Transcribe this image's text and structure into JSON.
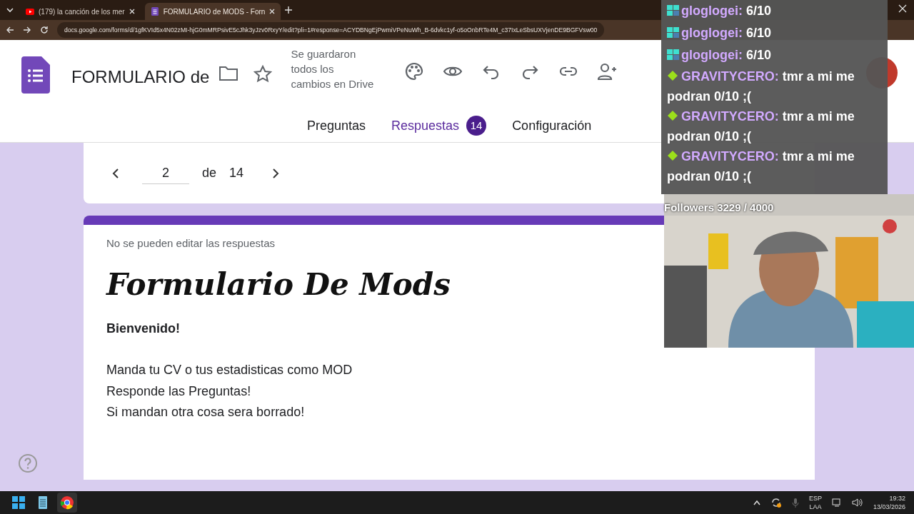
{
  "browser": {
    "tabs": [
      {
        "title": "(179) la canción de los mer",
        "kind": "video",
        "selected": false
      },
      {
        "title": "FORMULARIO de MODS - Forn",
        "kind": "form",
        "selected": true
      }
    ],
    "url": "docs.google.com/forms/d/1gfKVId5x4N02zMI-hjG0mMRPsivE5cJhk3yJzv0RxyY/edit?pli=1#response=ACYDBNgEjPwmiVPeNuWh_B-6dvkc1yf-o5oOnbRTe4M_c37IxLeSbsUXVjenDE9BGFVsw00"
  },
  "form_header": {
    "title": "FORMULARIO de",
    "save_status": "Se guardaron todos los cambios en Drive"
  },
  "tabs": [
    {
      "label": "Preguntas",
      "selected": false
    },
    {
      "label": "Respuestas",
      "selected": true,
      "badge": "14"
    },
    {
      "label": "Configuración",
      "selected": false
    }
  ],
  "pager": {
    "current": "2",
    "separator": "de",
    "total": "14"
  },
  "response": {
    "notice": "No se pueden editar las respuestas",
    "title": "Formulario De Mods",
    "blocks": [
      {
        "lines": [
          {
            "text": "Bienvenido!",
            "bold": true
          }
        ]
      },
      {
        "lines": [
          {
            "text": "Manda tu CV o tus estadisticas como MOD",
            "bold": false
          },
          {
            "text": "Responde las Preguntas!",
            "bold": false
          },
          {
            "text": "Si mandan otra cosa sera borrado!",
            "bold": false
          }
        ]
      }
    ]
  },
  "chat": {
    "messages": [
      {
        "kind": "robot",
        "user": "gloglogei:",
        "text": "6/10"
      },
      {
        "kind": "robot",
        "user": "gloglogei:",
        "text": "6/10"
      },
      {
        "kind": "robot",
        "user": "gloglogei:",
        "text": "6/10"
      },
      {
        "kind": "diamond",
        "user": "GRAVITYCERO:",
        "text": "tmr a mi me podran 0/10 ;("
      },
      {
        "kind": "diamond",
        "user": "GRAVITYCERO:",
        "text": "tmr a mi me podran 0/10 ;("
      },
      {
        "kind": "diamond",
        "user": "GRAVITYCERO:",
        "text": "tmr a mi me podran 0/10 ;("
      }
    ],
    "followers": "Followers 3229 / 4000"
  },
  "taskbar": {
    "apps": [
      {
        "kind": "start",
        "selected": false
      },
      {
        "kind": "notepad",
        "selected": false
      },
      {
        "kind": "browser",
        "selected": true
      }
    ],
    "language": [
      "ESP",
      "LAA"
    ],
    "time": "19:32",
    "date": "13/03/2026"
  }
}
